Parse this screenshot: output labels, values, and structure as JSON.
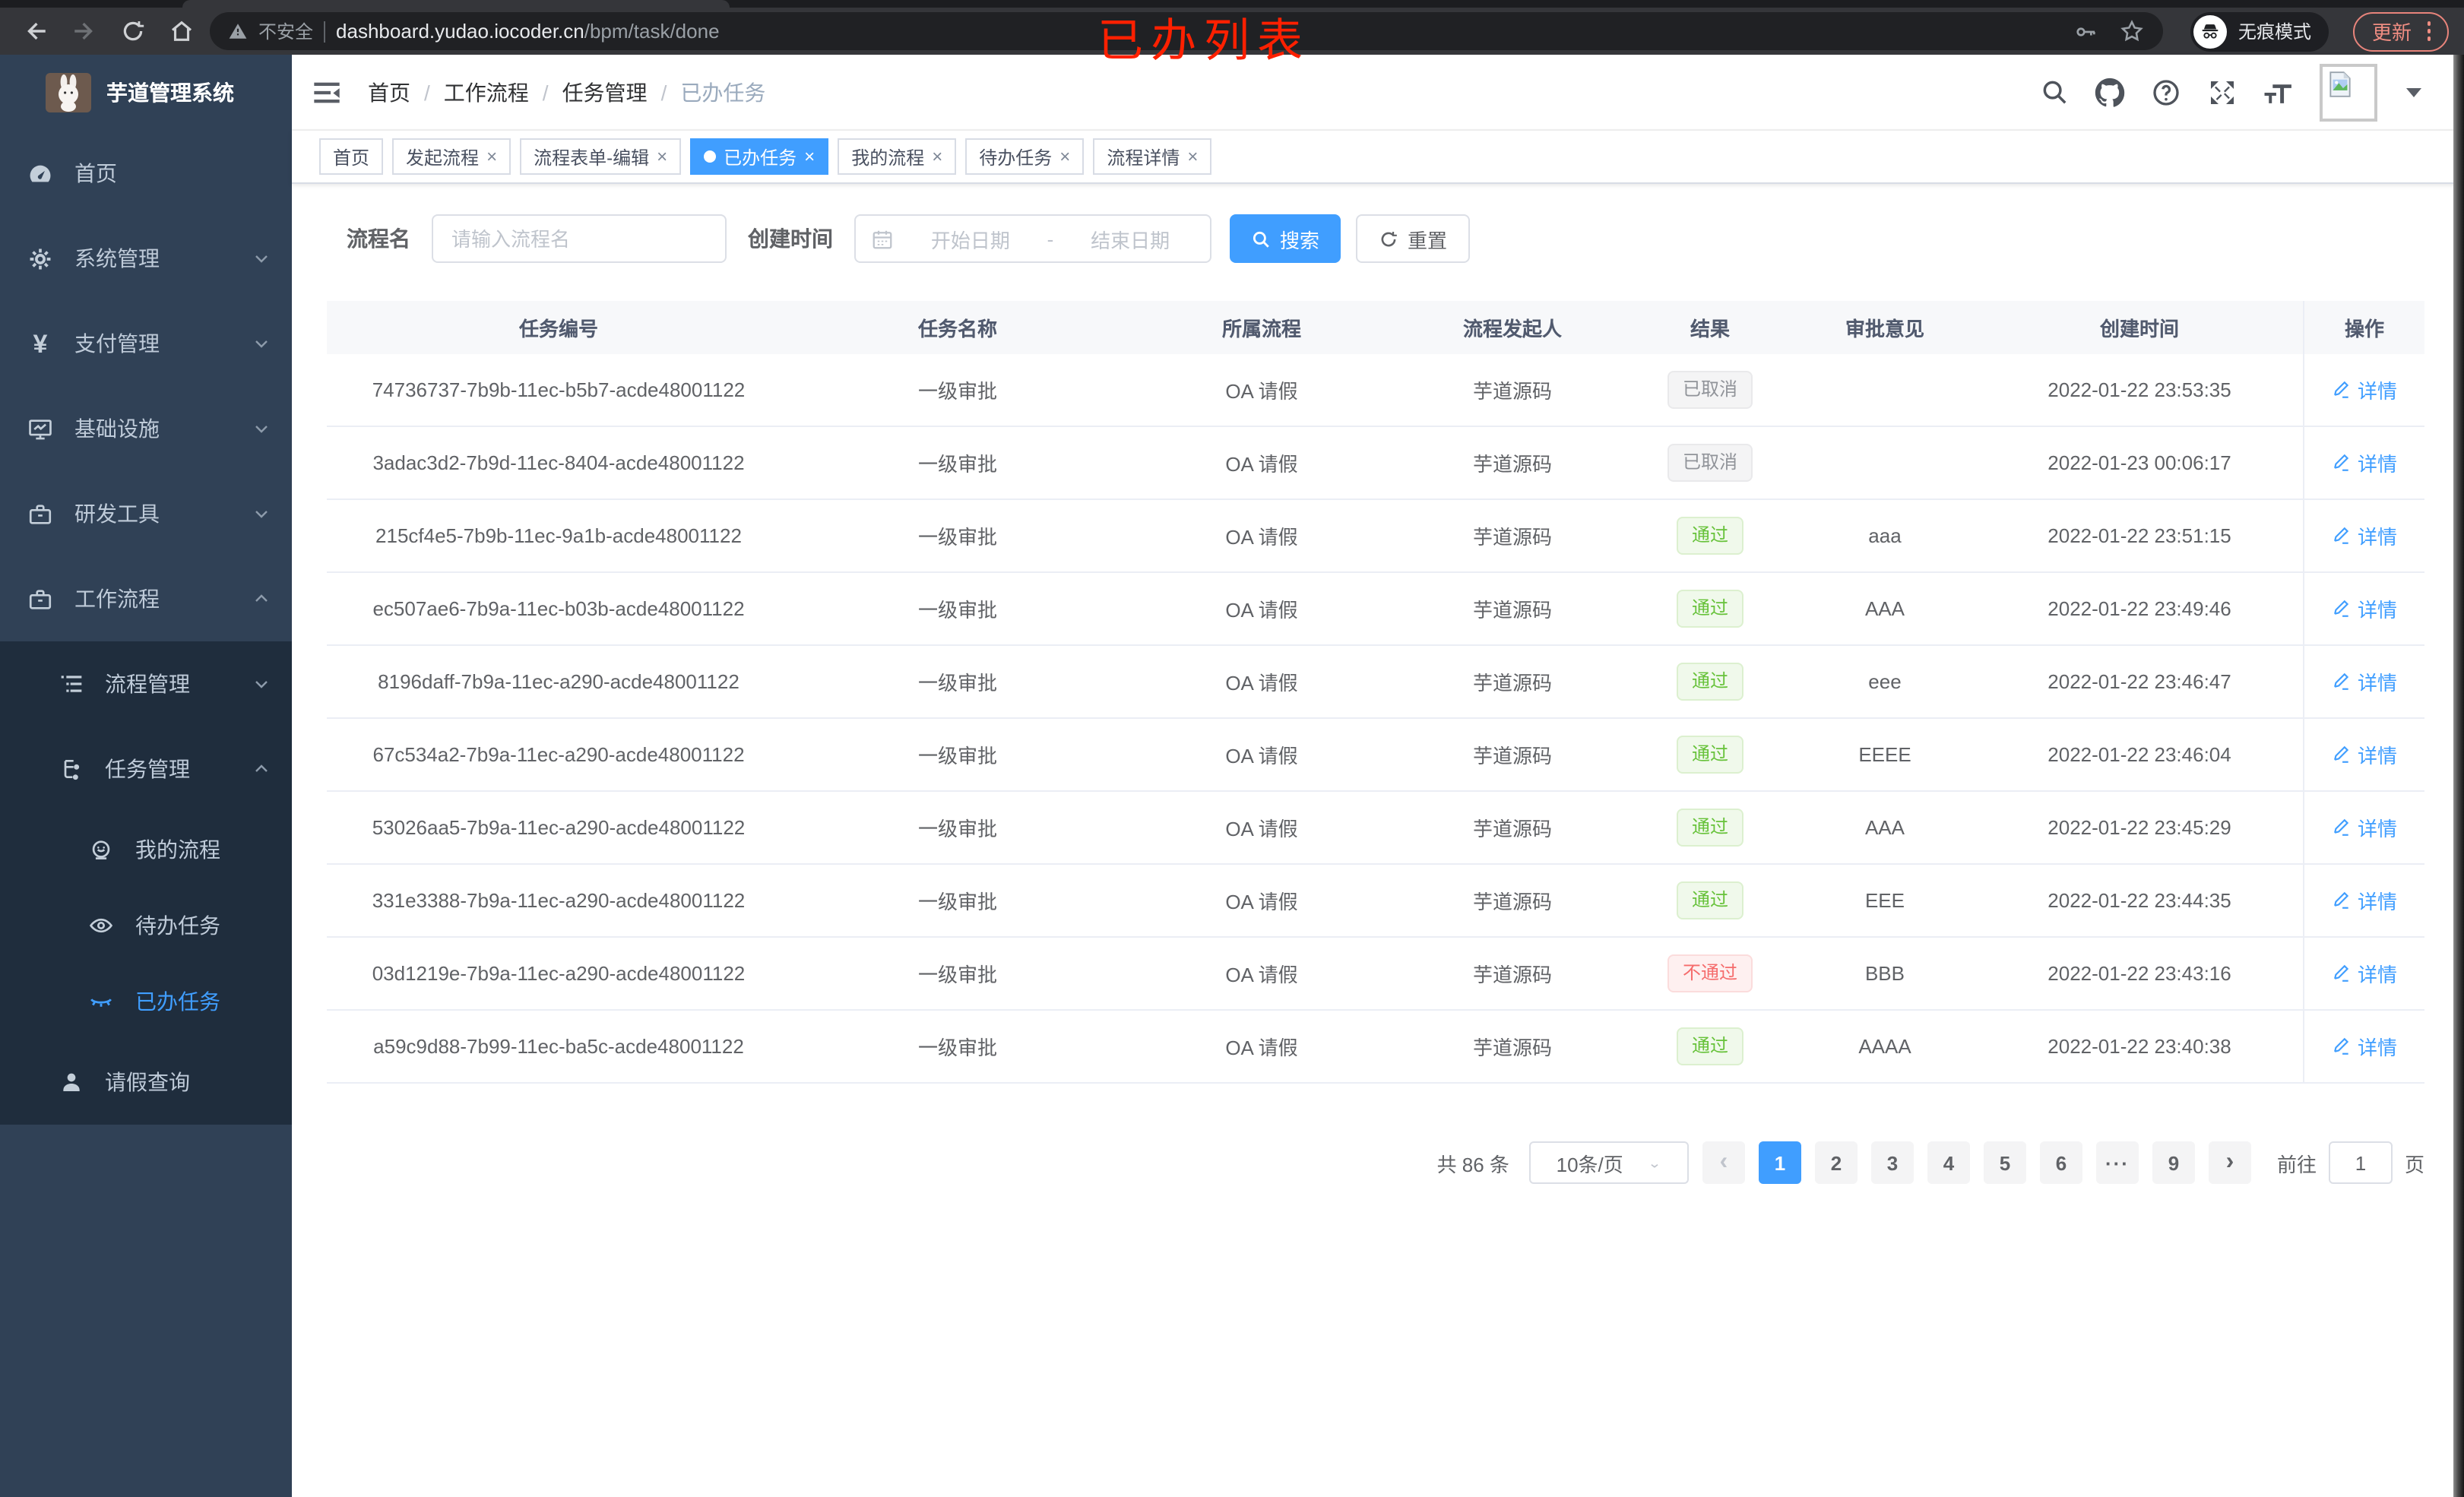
{
  "colors": {
    "accent": "#409eff",
    "sidebar_bg": "#304156",
    "submenu_bg": "#1f2d3d",
    "success_text": "#67c23a",
    "danger_text": "#f56c6c",
    "info_text": "#909399",
    "annotation_red": "#fe2000",
    "update_pill": "#ef8d82"
  },
  "browser": {
    "security_label": "不安全",
    "url_host": "dashboard.yudao.iocoder.cn",
    "url_path": "/bpm/task/done",
    "incognito_label": "无痕模式",
    "update_label": "更新",
    "annotation": "已办列表"
  },
  "sidebar": {
    "app_title": "芋道管理系统",
    "home": "首页",
    "system": "系统管理",
    "payment": "支付管理",
    "infra": "基础设施",
    "devtools": "研发工具",
    "workflow": "工作流程",
    "process_mgmt": "流程管理",
    "task_mgmt": "任务管理",
    "my_process": "我的流程",
    "todo_tasks": "待办任务",
    "done_tasks": "已办任务",
    "leave_query": "请假查询"
  },
  "breadcrumb": {
    "items": [
      "首页",
      "工作流程",
      "任务管理",
      "已办任务"
    ]
  },
  "tabs": [
    {
      "label": "首页"
    },
    {
      "label": "发起流程"
    },
    {
      "label": "流程表单-编辑"
    },
    {
      "label": "已办任务"
    },
    {
      "label": "我的流程"
    },
    {
      "label": "待办任务"
    },
    {
      "label": "流程详情"
    }
  ],
  "filter": {
    "name_label": "流程名",
    "name_placeholder": "请输入流程名",
    "time_label": "创建时间",
    "start_placeholder": "开始日期",
    "range_separator": "-",
    "end_placeholder": "结束日期",
    "search_label": "搜索",
    "reset_label": "重置"
  },
  "table": {
    "headers": [
      "任务编号",
      "任务名称",
      "所属流程",
      "流程发起人",
      "结果",
      "审批意见",
      "创建时间",
      "操作"
    ],
    "action_label": "详情",
    "rows": [
      {
        "id": "74736737-7b9b-11ec-b5b7-acde48001122",
        "name": "一级审批",
        "process": "OA 请假",
        "starter": "芋道源码",
        "result": "已取消",
        "result_type": "info",
        "comment": "",
        "time": "2022-01-22 23:53:35"
      },
      {
        "id": "3adac3d2-7b9d-11ec-8404-acde48001122",
        "name": "一级审批",
        "process": "OA 请假",
        "starter": "芋道源码",
        "result": "已取消",
        "result_type": "info",
        "comment": "",
        "time": "2022-01-23 00:06:17"
      },
      {
        "id": "215cf4e5-7b9b-11ec-9a1b-acde48001122",
        "name": "一级审批",
        "process": "OA 请假",
        "starter": "芋道源码",
        "result": "通过",
        "result_type": "success",
        "comment": "aaa",
        "time": "2022-01-22 23:51:15"
      },
      {
        "id": "ec507ae6-7b9a-11ec-b03b-acde48001122",
        "name": "一级审批",
        "process": "OA 请假",
        "starter": "芋道源码",
        "result": "通过",
        "result_type": "success",
        "comment": "AAA",
        "time": "2022-01-22 23:49:46"
      },
      {
        "id": "8196daff-7b9a-11ec-a290-acde48001122",
        "name": "一级审批",
        "process": "OA 请假",
        "starter": "芋道源码",
        "result": "通过",
        "result_type": "success",
        "comment": "eee",
        "time": "2022-01-22 23:46:47"
      },
      {
        "id": "67c534a2-7b9a-11ec-a290-acde48001122",
        "name": "一级审批",
        "process": "OA 请假",
        "starter": "芋道源码",
        "result": "通过",
        "result_type": "success",
        "comment": "EEEE",
        "time": "2022-01-22 23:46:04"
      },
      {
        "id": "53026aa5-7b9a-11ec-a290-acde48001122",
        "name": "一级审批",
        "process": "OA 请假",
        "starter": "芋道源码",
        "result": "通过",
        "result_type": "success",
        "comment": "AAA",
        "time": "2022-01-22 23:45:29"
      },
      {
        "id": "331e3388-7b9a-11ec-a290-acde48001122",
        "name": "一级审批",
        "process": "OA 请假",
        "starter": "芋道源码",
        "result": "通过",
        "result_type": "success",
        "comment": "EEE",
        "time": "2022-01-22 23:44:35"
      },
      {
        "id": "03d1219e-7b9a-11ec-a290-acde48001122",
        "name": "一级审批",
        "process": "OA 请假",
        "starter": "芋道源码",
        "result": "不通过",
        "result_type": "danger",
        "comment": "BBB",
        "time": "2022-01-22 23:43:16"
      },
      {
        "id": "a59c9d88-7b99-11ec-ba5c-acde48001122",
        "name": "一级审批",
        "process": "OA 请假",
        "starter": "芋道源码",
        "result": "通过",
        "result_type": "success",
        "comment": "AAAA",
        "time": "2022-01-22 23:40:38"
      }
    ]
  },
  "pagination": {
    "total": "共 86 条",
    "page_size": "10条/页",
    "prev": "‹",
    "pages": [
      "1",
      "2",
      "3",
      "4",
      "5",
      "6"
    ],
    "ellipsis": "···",
    "last_page": "9",
    "next": "›",
    "goto_label": "前往",
    "goto_value": "1",
    "page_unit": "页"
  }
}
